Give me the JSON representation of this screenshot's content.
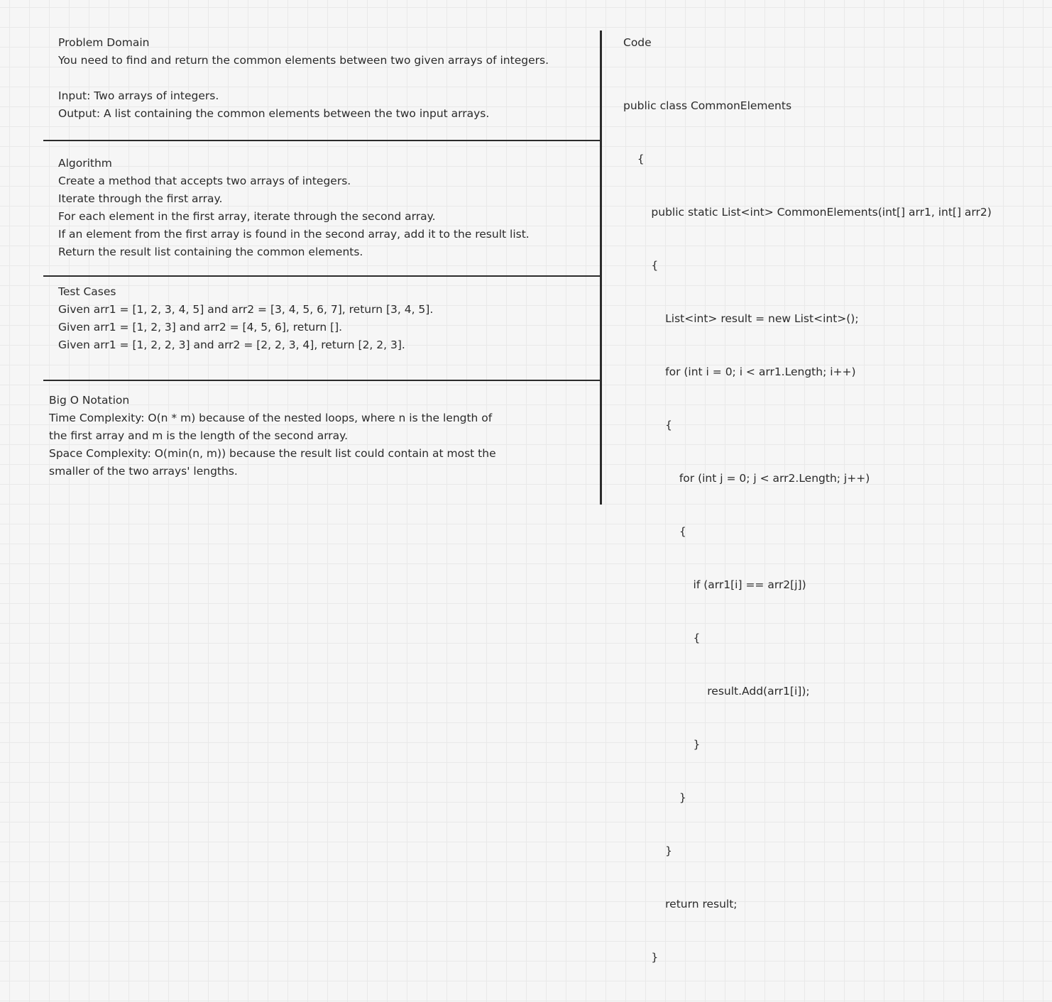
{
  "problem_domain": {
    "title": "Problem Domain",
    "description": "You need to find and return the common elements between two given arrays of integers.",
    "input": "Input: Two arrays of integers.",
    "output": "Output: A list containing the common elements between the two input arrays."
  },
  "algorithm": {
    "title": "Algorithm",
    "steps": [
      "Create a method that accepts two arrays of integers.",
      "Iterate through the first array.",
      "For each element in the first array, iterate through the second array.",
      "If an element from the first array is found in the second array, add it to the result list.",
      "Return the result list containing the common elements."
    ]
  },
  "test_cases": {
    "title": "Test Cases",
    "cases": [
      "Given arr1 = [1, 2, 3, 4, 5] and arr2 = [3, 4, 5, 6, 7], return [3, 4, 5].",
      "Given arr1 = [1, 2, 3] and arr2 = [4, 5, 6], return [].",
      "Given arr1 = [1, 2, 2, 3] and arr2 = [2, 2, 3, 4], return [2, 2, 3]."
    ]
  },
  "big_o": {
    "title": "Big O Notation",
    "lines": [
      "Time Complexity: O(n * m) because of the nested loops, where n is the length of",
      "the first array and m is the length of the second array.",
      "Space Complexity: O(min(n, m)) because the result list could contain at most the",
      "smaller of the two arrays' lengths."
    ]
  },
  "code": {
    "title": "Code",
    "lines": [
      "public class CommonElements",
      "    {",
      "        public static List<int> CommonElements(int[] arr1, int[] arr2)",
      "        {",
      "            List<int> result = new List<int>();",
      "            for (int i = 0; i < arr1.Length; i++)",
      "            {",
      "                for (int j = 0; j < arr2.Length; j++)",
      "                {",
      "                    if (arr1[i] == arr2[j])",
      "                    {",
      "                        result.Add(arr1[i]);",
      "                    }",
      "                }",
      "            }",
      "            return result;",
      "        }"
    ]
  }
}
